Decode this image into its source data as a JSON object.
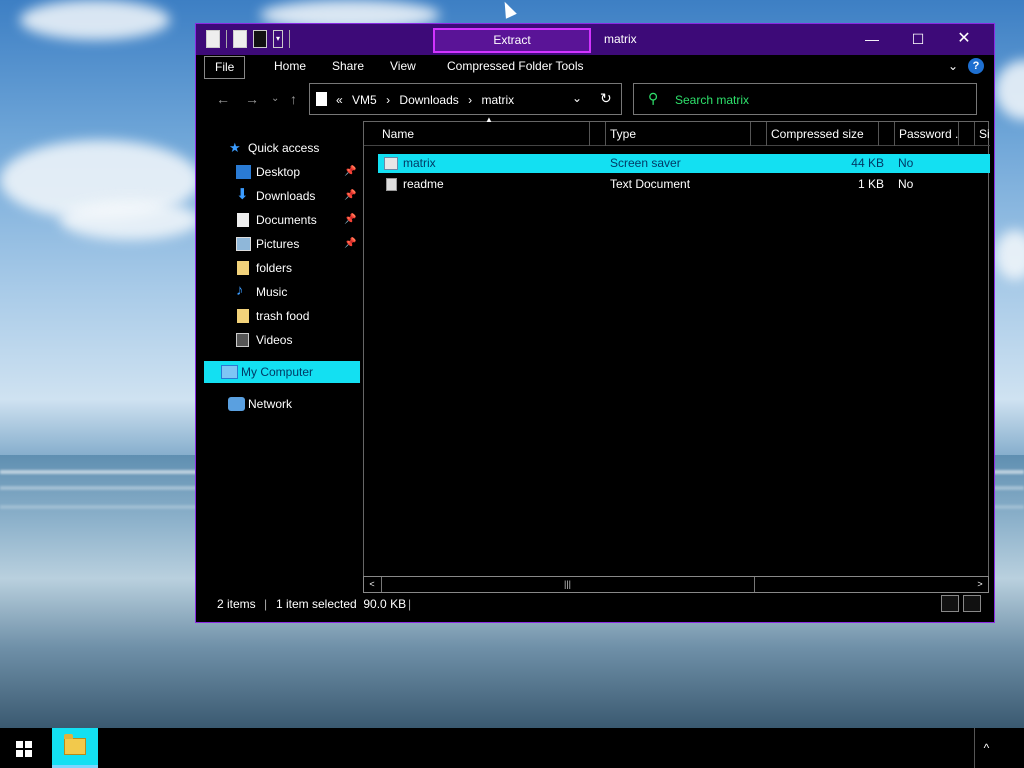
{
  "window": {
    "title": "matrix",
    "context_tab": "Extract",
    "controls": {
      "minimize": "—",
      "maximize": "☐",
      "close": "✕"
    }
  },
  "ribbon": {
    "tabs": [
      "File",
      "Home",
      "Share",
      "View",
      "Compressed Folder Tools"
    ]
  },
  "address": {
    "crumbs": [
      "«",
      "VM5",
      "›",
      "Downloads",
      "›",
      "matrix"
    ]
  },
  "search": {
    "placeholder": "Search matrix"
  },
  "nav": {
    "quick_access": "Quick access",
    "items": [
      {
        "label": "Desktop",
        "pinned": true
      },
      {
        "label": "Downloads",
        "pinned": true
      },
      {
        "label": "Documents",
        "pinned": true
      },
      {
        "label": "Pictures",
        "pinned": true
      },
      {
        "label": "folders",
        "pinned": false
      },
      {
        "label": "Music",
        "pinned": false
      },
      {
        "label": "trash food",
        "pinned": false
      },
      {
        "label": "Videos",
        "pinned": false
      }
    ],
    "my_computer": "My Computer",
    "network": "Network"
  },
  "columns": [
    "Name",
    "Type",
    "Compressed size",
    "Password ...",
    "Si"
  ],
  "files": [
    {
      "name": "matrix",
      "type": "Screen saver",
      "size": "44 KB",
      "password": "No",
      "selected": true
    },
    {
      "name": "readme",
      "type": "Text Document",
      "size": "1 KB",
      "password": "No",
      "selected": false
    }
  ],
  "status": {
    "count": "2 items",
    "selection": "1 item selected  90.0 KB"
  },
  "colors": {
    "accent": "#13e0f2",
    "title_bar": "#3d0a78",
    "search_text": "#2ee06b"
  }
}
